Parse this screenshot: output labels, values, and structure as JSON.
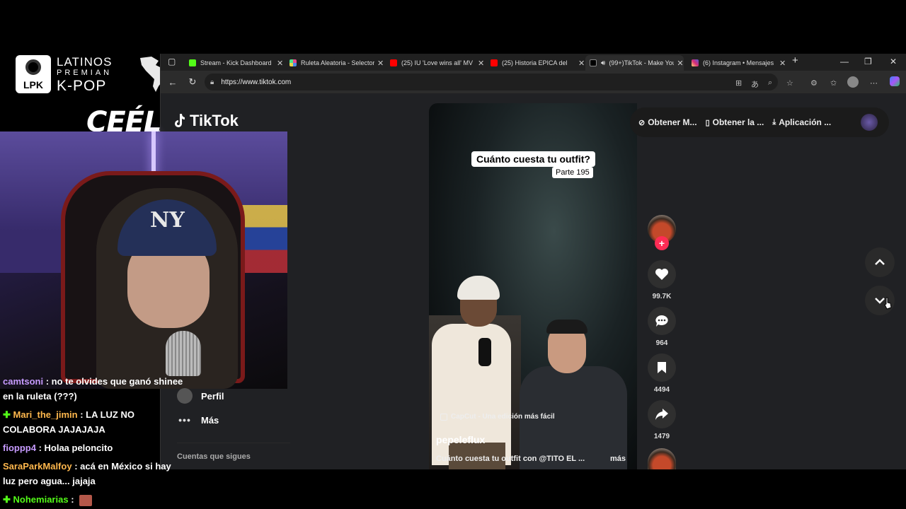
{
  "logo": {
    "badge": "LPK",
    "line1": "LATINOS",
    "line2": "PREMIAN",
    "line3": "K-POP"
  },
  "overlay": {
    "ceela": "CEÉLA"
  },
  "browser": {
    "tabs": [
      {
        "title": "Stream - Kick Dashboard",
        "color": "#53fc18"
      },
      {
        "title": "Ruleta Aleatoria - Selector",
        "color": "#e84b8a"
      },
      {
        "title": "(25) IU 'Love wins all' MV",
        "color": "#ff0000"
      },
      {
        "title": "(25) Historia EPICA del",
        "color": "#ff0000"
      },
      {
        "title": "(99+)TikTok - Make Your Day",
        "color": "#111111"
      },
      {
        "title": "(6) Instagram • Mensajes",
        "color": "#d62976"
      }
    ],
    "url": "https://www.tiktok.com"
  },
  "tiktok": {
    "logo": "TikTok",
    "topbar": {
      "btn1": "Obtener M...",
      "btn2": "Obtener la ...",
      "btn3": "Aplicación ..."
    },
    "sidebar": {
      "profile": "Perfil",
      "more": "Más",
      "following": "Cuentas que sigues"
    },
    "video": {
      "caption": "Cuánto cuesta tu outfit?",
      "part": "Parte 195",
      "capcut": "CapCut - Una edición más fácil",
      "author": "pepeleflux",
      "description": "Cuánto cuesta tu outfit con @TITO EL ...",
      "more": "más"
    },
    "actions": {
      "likes": "99.7K",
      "comments": "964",
      "saves": "4494",
      "shares": "1479"
    }
  },
  "chat": [
    {
      "user": "camtsoni",
      "color": "#c79bff",
      "text": ": no te olvides que ganó shinee en la ruleta (???)",
      "icon": ""
    },
    {
      "user": "Mari_the_jimin",
      "color": "#ffb84d",
      "text": ": LA LUZ NO COLABORA JAJAJAJA",
      "icon": "✚"
    },
    {
      "user": "fioppp4",
      "color": "#c79bff",
      "text": ": Holaa peloncito",
      "icon": ""
    },
    {
      "user": "SaraParkMalfoy",
      "color": "#ffb84d",
      "text": ": acá en México si hay luz pero agua... jajaja",
      "icon": ""
    },
    {
      "user": "Nohemiarias",
      "color": "#53fc18",
      "text": ":",
      "icon": "✚"
    }
  ]
}
